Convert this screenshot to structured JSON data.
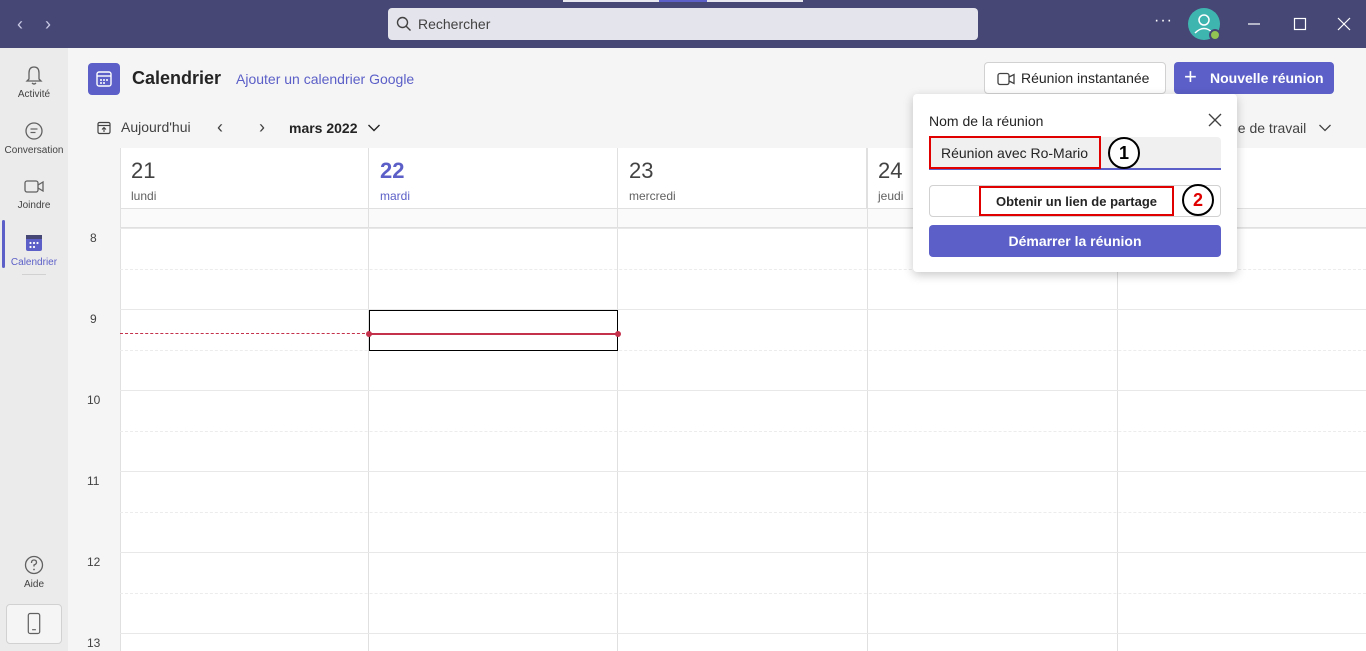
{
  "titlebar": {
    "search_placeholder": "Rechercher",
    "more_label": "···"
  },
  "rail": {
    "items": [
      {
        "label": "Activité",
        "icon": "bell-icon"
      },
      {
        "label": "Conversation",
        "icon": "chat-icon"
      },
      {
        "label": "Joindre",
        "icon": "video-icon"
      },
      {
        "label": "Calendrier",
        "icon": "calendar-icon",
        "active": true
      }
    ],
    "help_label": "Aide"
  },
  "header": {
    "title": "Calendrier",
    "google_link": "Ajouter un calendrier Google",
    "instant_meeting": "Réunion instantanée",
    "new_meeting": "Nouvelle réunion"
  },
  "toolbar": {
    "today": "Aujourd'hui",
    "month": "mars 2022",
    "view_partial": "ne de travail"
  },
  "calendar": {
    "days": [
      {
        "num": "21",
        "name": "lundi"
      },
      {
        "num": "22",
        "name": "mardi",
        "today": true
      },
      {
        "num": "23",
        "name": "mercredi"
      },
      {
        "num": "24",
        "name": "jeudi"
      },
      {
        "num": "",
        "name": ""
      }
    ],
    "hours": [
      "8",
      "9",
      "10",
      "11",
      "12",
      "13"
    ]
  },
  "popup": {
    "title": "Nom de la réunion",
    "meeting_name": "Réunion avec Ro-Mario",
    "share_link": "Obtenir un lien de partage",
    "start": "Démarrer la réunion",
    "marker1": "1",
    "marker2": "2"
  },
  "colors": {
    "brand": "#5b5fc7",
    "titlebar": "#464775",
    "now_line": "#c4314b",
    "annotation_red": "#e00000"
  }
}
